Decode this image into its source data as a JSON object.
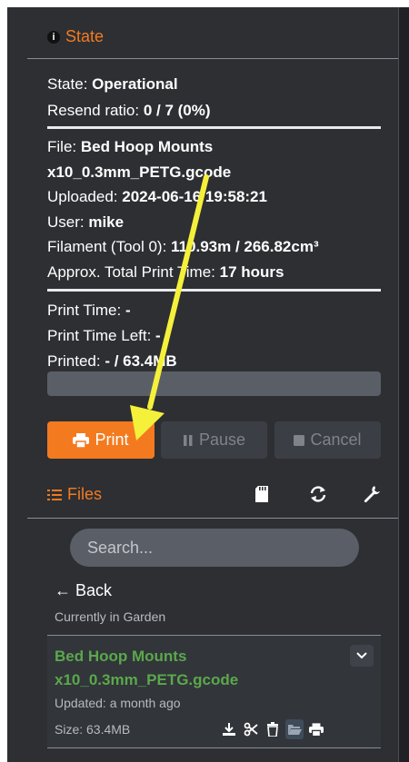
{
  "state": {
    "title": "State",
    "state_label": "State: ",
    "state_value": "Operational",
    "resend_label": "Resend ratio: ",
    "resend_value": "0 / 7 (0%)",
    "file_label": "File: ",
    "file_value_1": "Bed Hoop Mounts",
    "file_value_2": "x10_0.3mm_PETG.gcode",
    "uploaded_label": "Uploaded: ",
    "uploaded_value": "2024-06-16 19:58:21",
    "user_label": "User: ",
    "user_value": "mike",
    "filament_label": "Filament (Tool 0): ",
    "filament_value": "110.93m / 266.82cm³",
    "approx_label": "Approx. Total Print Time: ",
    "approx_value": "17 hours",
    "print_time_label": "Print Time: ",
    "print_time_value": "-",
    "time_left_label": "Print Time Left: ",
    "time_left_value": "-",
    "printed_label": "Printed: ",
    "printed_value": "- / 63.4MB",
    "progress_fraction": 0
  },
  "buttons": {
    "print": "Print",
    "pause": "Pause",
    "cancel": "Cancel"
  },
  "files": {
    "title": "Files",
    "search_placeholder": "Search...",
    "back_label": "← Back",
    "currently_label": "Currently in Garden",
    "item": {
      "name": "Bed Hoop Mounts x10_0.3mm_PETG.gcode",
      "updated": "Updated: a month ago",
      "size": "Size: 63.4MB"
    }
  },
  "colors": {
    "accent": "#f47a1f",
    "panel": "#2d2f33",
    "file_name": "#5aa84c",
    "annotation_arrow": "#f5f03a"
  }
}
